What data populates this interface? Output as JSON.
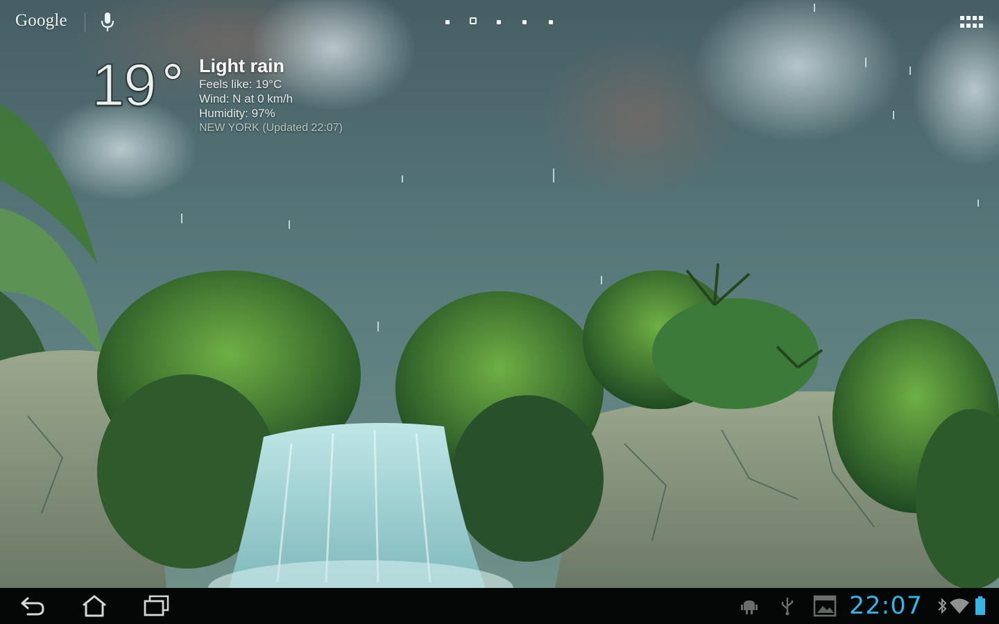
{
  "search_bar": {
    "brand_label": "Google",
    "icons": {
      "voice": "microphone-icon",
      "apps": "app-drawer-grid-icon"
    }
  },
  "home_pages": {
    "count": 5,
    "current_index": 1
  },
  "weather": {
    "temperature": "19",
    "condition": "Light rain",
    "feels_like": "Feels like: 19°C",
    "wind": "Wind: N at 0 km/h",
    "humidity": "Humidity: 97%",
    "location_updated": "NEW YORK (Updated 22:07)"
  },
  "system_bar": {
    "nav_icons": [
      "back-icon",
      "home-icon",
      "recent-apps-icon"
    ],
    "status_icons": [
      "android-debug-icon",
      "usb-icon",
      "gallery-notification-icon",
      "bluetooth-icon",
      "wifi-icon",
      "battery-icon"
    ],
    "clock": "22:07",
    "accent_color": "#33b5e5"
  },
  "wallpaper": "tropical-waterfall-rain-live-wallpaper"
}
